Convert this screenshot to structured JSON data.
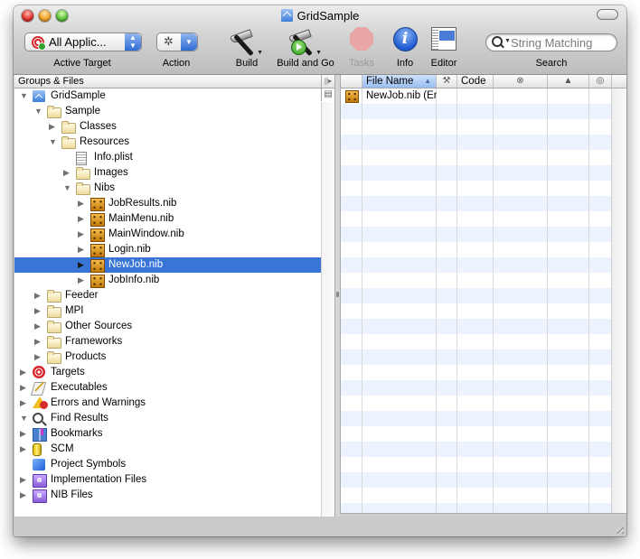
{
  "window": {
    "title": "GridSample",
    "title_icon": "xcode-project-icon"
  },
  "toolbar": {
    "active_target": {
      "value": "All Applic...",
      "label": "Active Target",
      "icon": "target-icon"
    },
    "action": {
      "label": "Action",
      "icon": "gear-icon"
    },
    "build": {
      "label": "Build",
      "icon": "hammer-icon"
    },
    "build_and_go": {
      "label": "Build and Go",
      "icon": "hammer-go-icon"
    },
    "tasks": {
      "label": "Tasks",
      "icon": "stop-icon",
      "enabled": false
    },
    "info": {
      "label": "Info",
      "icon": "info-icon",
      "glyph": "i"
    },
    "editor": {
      "label": "Editor",
      "icon": "editor-icon"
    },
    "search": {
      "placeholder": "String Matching",
      "label": "Search"
    }
  },
  "groups": {
    "header": "Groups & Files",
    "items": [
      {
        "label": "GridSample",
        "icon": "project",
        "depth": 0,
        "disclosure": "open"
      },
      {
        "label": "Sample",
        "icon": "folder",
        "depth": 1,
        "disclosure": "open"
      },
      {
        "label": "Classes",
        "icon": "folder",
        "depth": 2,
        "disclosure": "closed"
      },
      {
        "label": "Resources",
        "icon": "folder",
        "depth": 2,
        "disclosure": "open"
      },
      {
        "label": "Info.plist",
        "icon": "plist",
        "depth": 3,
        "disclosure": "none"
      },
      {
        "label": "Images",
        "icon": "folder",
        "depth": 3,
        "disclosure": "closed"
      },
      {
        "label": "Nibs",
        "icon": "folder",
        "depth": 3,
        "disclosure": "open"
      },
      {
        "label": "JobResults.nib",
        "icon": "nib",
        "depth": 4,
        "disclosure": "closed"
      },
      {
        "label": "MainMenu.nib",
        "icon": "nib",
        "depth": 4,
        "disclosure": "closed"
      },
      {
        "label": "MainWindow.nib",
        "icon": "nib",
        "depth": 4,
        "disclosure": "closed"
      },
      {
        "label": "Login.nib",
        "icon": "nib",
        "depth": 4,
        "disclosure": "closed"
      },
      {
        "label": "NewJob.nib",
        "icon": "nib",
        "depth": 4,
        "disclosure": "closed",
        "selected": true
      },
      {
        "label": "JobInfo.nib",
        "icon": "nib",
        "depth": 4,
        "disclosure": "closed"
      },
      {
        "label": "Feeder",
        "icon": "folder",
        "depth": 1,
        "disclosure": "closed"
      },
      {
        "label": "MPI",
        "icon": "folder",
        "depth": 1,
        "disclosure": "closed"
      },
      {
        "label": "Other Sources",
        "icon": "folder",
        "depth": 1,
        "disclosure": "closed"
      },
      {
        "label": "Frameworks",
        "icon": "folder",
        "depth": 1,
        "disclosure": "closed"
      },
      {
        "label": "Products",
        "icon": "folder",
        "depth": 1,
        "disclosure": "closed"
      },
      {
        "label": "Targets",
        "icon": "targets",
        "depth": 0,
        "disclosure": "closed"
      },
      {
        "label": "Executables",
        "icon": "executables",
        "depth": 0,
        "disclosure": "closed"
      },
      {
        "label": "Errors and Warnings",
        "icon": "warnings",
        "depth": 0,
        "disclosure": "closed"
      },
      {
        "label": "Find Results",
        "icon": "find",
        "depth": 0,
        "disclosure": "open"
      },
      {
        "label": "Bookmarks",
        "icon": "bookmarks",
        "depth": 0,
        "disclosure": "closed"
      },
      {
        "label": "SCM",
        "icon": "scm",
        "depth": 0,
        "disclosure": "closed"
      },
      {
        "label": "Project Symbols",
        "icon": "symbols",
        "depth": 0,
        "disclosure": "none"
      },
      {
        "label": "Implementation Files",
        "icon": "smartgroup",
        "depth": 0,
        "disclosure": "closed"
      },
      {
        "label": "NIB Files",
        "icon": "smartgroup",
        "depth": 0,
        "disclosure": "closed"
      }
    ]
  },
  "detail": {
    "columns": [
      {
        "key": "icon",
        "label": "",
        "glyph": ""
      },
      {
        "key": "file_name",
        "label": "File Name",
        "sorted": "ascending"
      },
      {
        "key": "build",
        "label": "",
        "glyph": "⚒"
      },
      {
        "key": "code",
        "label": "Code"
      },
      {
        "key": "errors",
        "label": "",
        "glyph": "⊗"
      },
      {
        "key": "warnings",
        "label": "",
        "glyph": "▲"
      },
      {
        "key": "target",
        "label": "",
        "glyph": "◎"
      }
    ],
    "rows": [
      {
        "icon": "nib",
        "file_name": "NewJob.nib (En",
        "build": "",
        "code": "",
        "errors": "",
        "warnings": "",
        "target": ""
      }
    ]
  }
}
